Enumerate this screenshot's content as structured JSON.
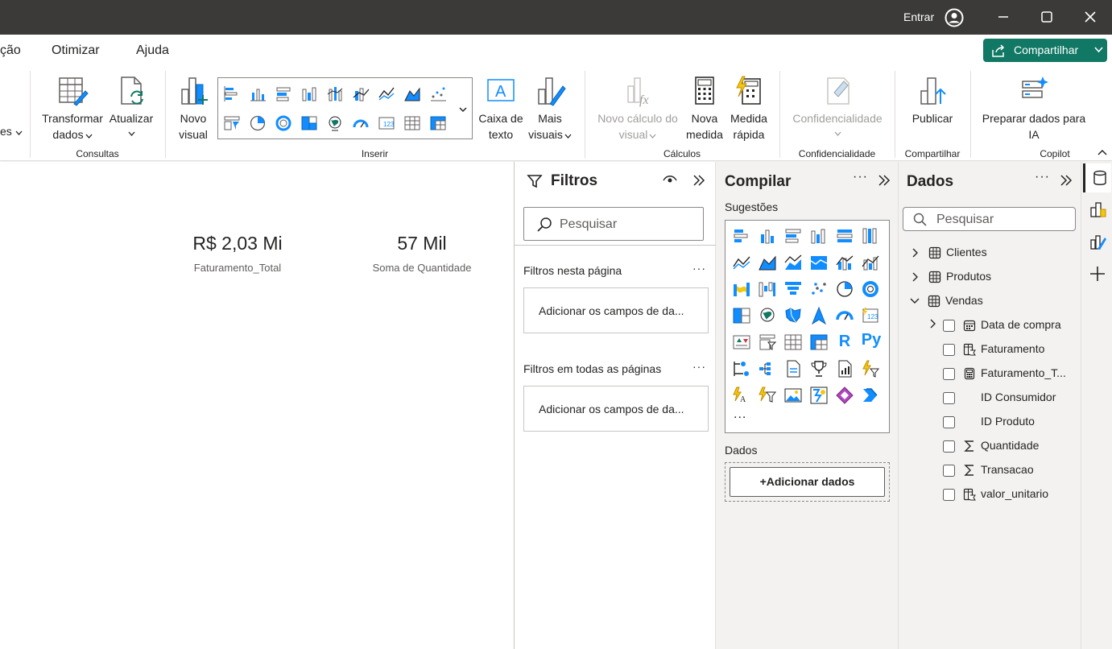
{
  "titlebar": {
    "signin": "Entrar"
  },
  "menu": {
    "items": [
      "ção",
      "Otimizar",
      "Ajuda"
    ],
    "share_label": "Compartilhar"
  },
  "ribbon": {
    "left_partial": "es",
    "groups": {
      "consultas": {
        "label": "Consultas",
        "transform": [
          "Transformar",
          "dados"
        ],
        "refresh": "Atualizar"
      },
      "inserir": {
        "label": "Inserir",
        "new_visual": [
          "Novo",
          "visual"
        ],
        "text_box": [
          "Caixa de",
          "texto"
        ],
        "more_visuals": [
          "Mais",
          "visuais"
        ]
      },
      "calculos": {
        "label": "Cálculos",
        "new_visual_calc": [
          "Novo cálculo do",
          "visual"
        ],
        "new_measure": [
          "Nova",
          "medida"
        ],
        "quick_measure": [
          "Medida",
          "rápida"
        ]
      },
      "confidencialidade": {
        "label": "Confidencialidade",
        "sensitivity": "Confidencialidade"
      },
      "compartilhar": {
        "label": "Compartilhar",
        "publish": "Publicar"
      },
      "copilot": {
        "label": "Copilot",
        "prepare": [
          "Preparar dados para",
          "IA"
        ]
      }
    }
  },
  "canvas": {
    "cards": [
      {
        "value": "R$ 2,03 Mi",
        "label": "Faturamento_Total"
      },
      {
        "value": "57 Mil",
        "label": "Soma de Quantidade"
      }
    ]
  },
  "filters": {
    "title": "Filtros",
    "search_placeholder": "Pesquisar",
    "this_page": "Filtros nesta página",
    "all_pages": "Filtros em todas as páginas",
    "add_fields": "Adicionar os campos de da..."
  },
  "build": {
    "title": "Compilar",
    "suggestions": "Sugestões",
    "r_label": "R",
    "py_label": "Py",
    "more": "...",
    "data_label": "Dados",
    "add_data": "+Adicionar dados"
  },
  "data": {
    "title": "Dados",
    "search_placeholder": "Pesquisar",
    "tables": [
      "Clientes",
      "Produtos",
      "Vendas"
    ],
    "fields": [
      "Data de compra",
      "Faturamento",
      "Faturamento_T...",
      "ID Consumidor",
      "ID Produto",
      "Quantidade",
      "Transacao",
      "valor_unitario"
    ]
  },
  "colors": {
    "titlebar": "#3b3a39",
    "share": "#117865",
    "accent": "#118dff",
    "pane_bg": "#f3f2f1"
  }
}
